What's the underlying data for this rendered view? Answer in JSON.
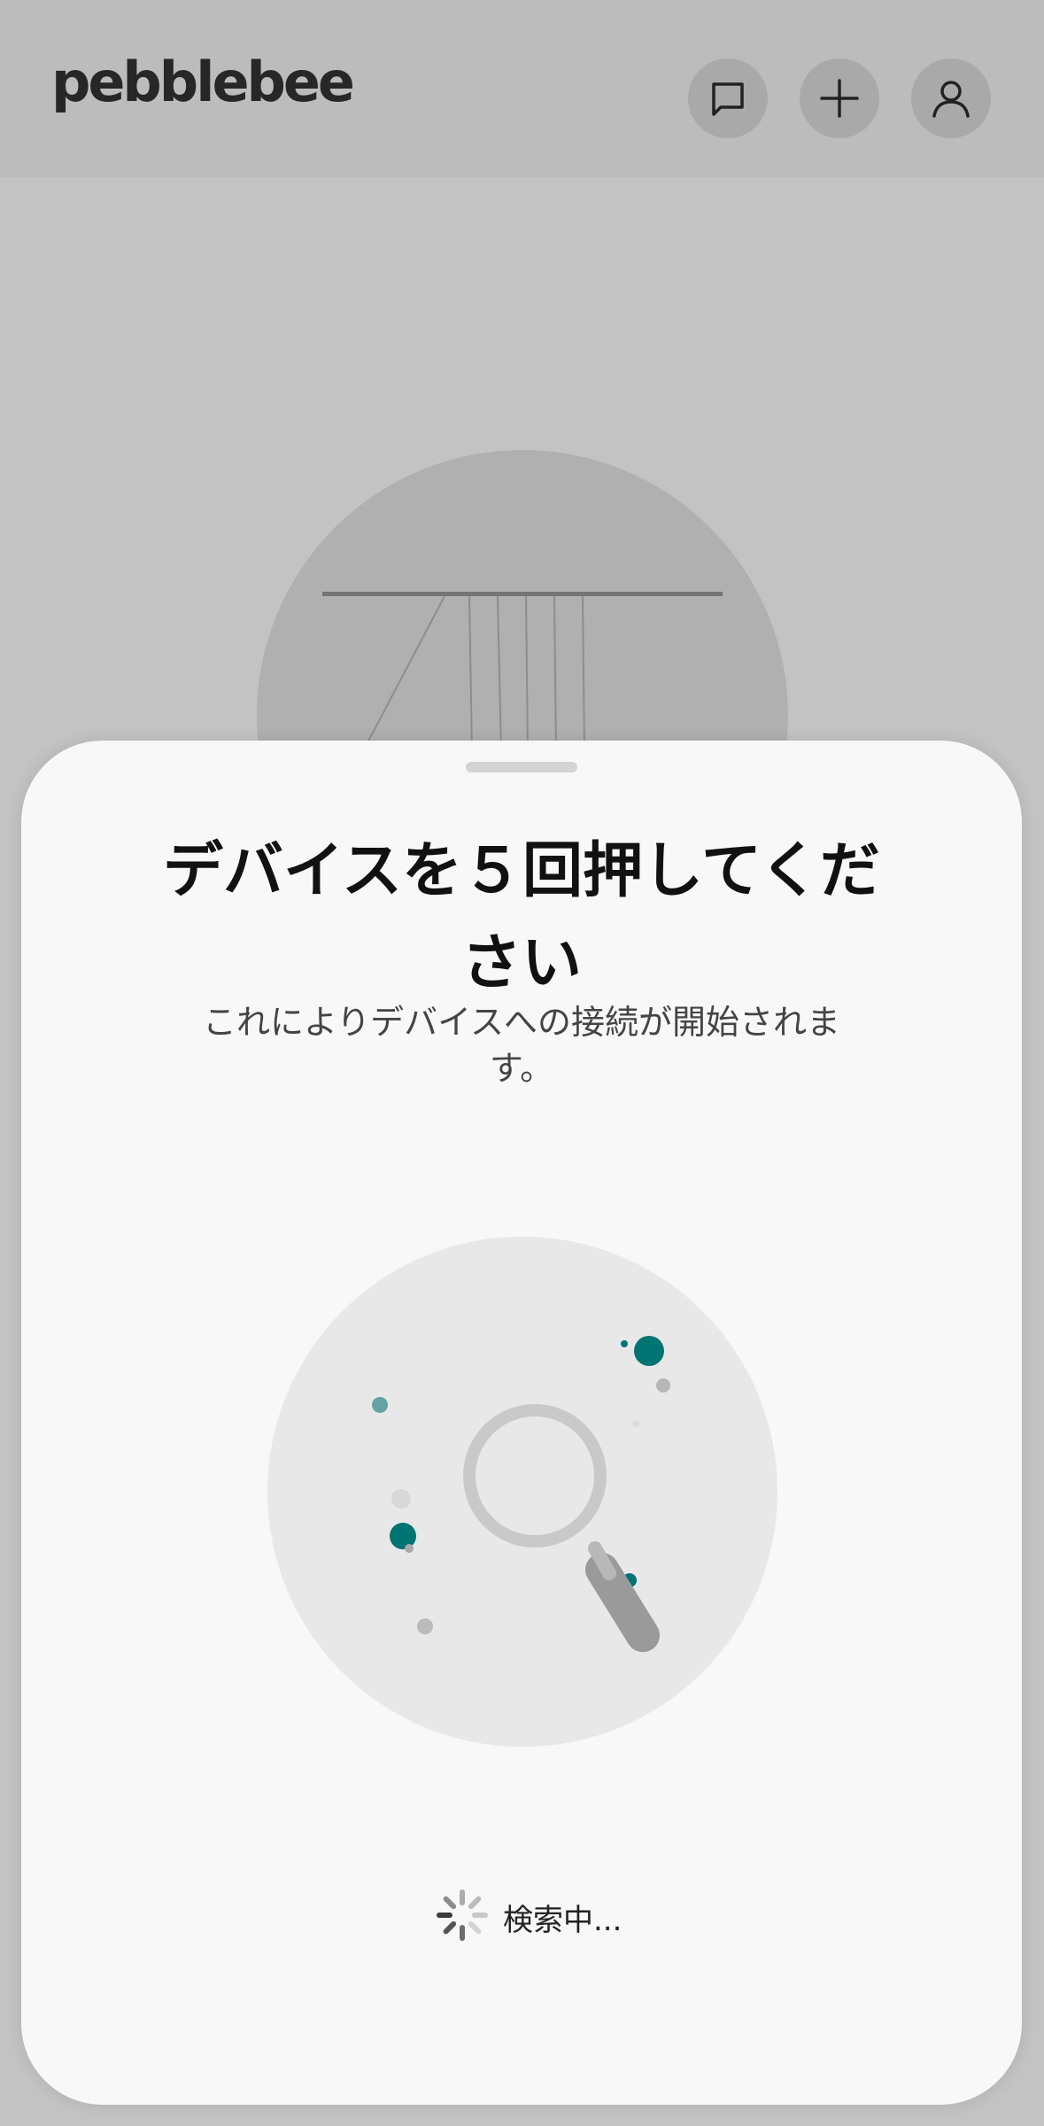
{
  "header": {
    "logo_text": "pebblebee",
    "buttons": [
      {
        "icon": "chat-icon"
      },
      {
        "icon": "plus-icon"
      },
      {
        "icon": "profile-icon"
      }
    ]
  },
  "sheet": {
    "title": "デバイスを５回押してください",
    "subtitle": "これによりデバイスへの接続が開始されます。",
    "status_text": "検索中...",
    "illustration_icon": "magnifier-icon",
    "spinner_icon": "spinner-icon"
  },
  "colors": {
    "accent": "#007373",
    "background": "#c3c3c3",
    "sheet": "#f8f8f8"
  }
}
